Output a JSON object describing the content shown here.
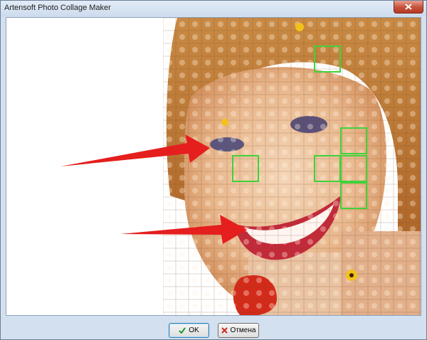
{
  "window": {
    "title": "Artensoft Photo Collage Maker"
  },
  "titlebar": {
    "close_icon": "close-icon"
  },
  "canvas": {
    "description_icon": "photo-mosaic",
    "annotations": {
      "arrow_color": "#e51e1e",
      "highlight_color": "#3fd23a"
    }
  },
  "footer": {
    "ok_label": "OK",
    "ok_icon": "checkmark-icon",
    "cancel_label": "Отмена",
    "cancel_icon": "x-icon"
  },
  "colors": {
    "frame": "#d3e0ef",
    "close": "#c6503a",
    "ok_check": "#1e9a2c",
    "cancel_x": "#d12a1e"
  }
}
